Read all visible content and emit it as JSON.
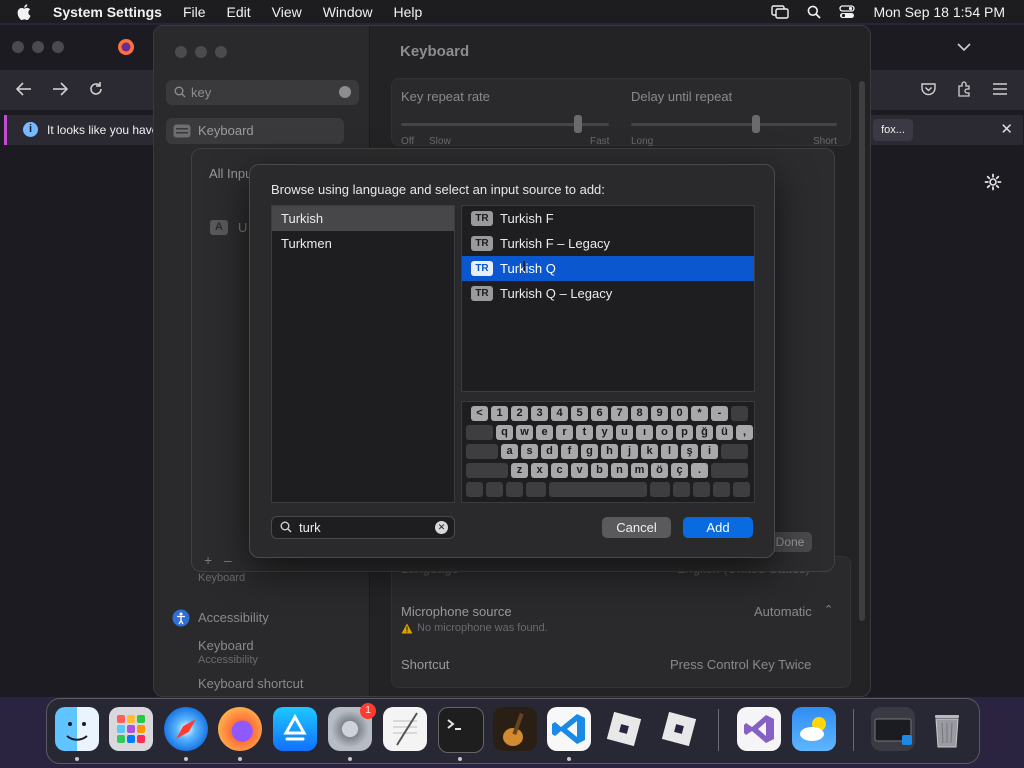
{
  "menubar": {
    "app_name": "System Settings",
    "menus": [
      "File",
      "Edit",
      "View",
      "Window",
      "Help"
    ],
    "datetime": "Mon Sep 18  1:54 PM"
  },
  "browser": {
    "notice_text": "It looks like you have",
    "notice_button": "fox..."
  },
  "settings": {
    "window_title": "Keyboard",
    "search_value": "key",
    "sidebar_selected": "Keyboard",
    "sidebar_items": [
      {
        "label": "Keyboard",
        "sub": ""
      },
      {
        "label": "Accessibility",
        "sub": ""
      },
      {
        "label": "Keyboard",
        "sub": "Accessibility"
      },
      {
        "label": "Keyboard shortcut",
        "sub": ""
      }
    ],
    "sidebar_keyboard_caption": "Keyboard",
    "key_repeat_rate": {
      "label": "Key repeat rate",
      "left": "Off",
      "left2": "Slow",
      "right": "Fast",
      "level": 0.85
    },
    "delay_until_repeat": {
      "label": "Delay until repeat",
      "left": "Long",
      "right": "Short",
      "level": 0.6
    },
    "language_label": "Language",
    "language_value": "English (United States)",
    "microphone_label": "Microphone source",
    "microphone_value": "Automatic",
    "microphone_warning": "No microphone was found.",
    "shortcut_label": "Shortcut",
    "shortcut_value": "Press Control Key Twice"
  },
  "input_sheet": {
    "heading": "All Inpu",
    "source_badge": "A",
    "source_label": "U",
    "done_label": "Done"
  },
  "dialog": {
    "prompt": "Browse using language and select an input source to add:",
    "languages": [
      {
        "label": "Turkish",
        "selected": true
      },
      {
        "label": "Turkmen",
        "selected": false
      }
    ],
    "sources": [
      {
        "badge": "TR",
        "label": "Turkish F",
        "selected": false
      },
      {
        "badge": "TR",
        "label": "Turkish F – Legacy",
        "selected": false
      },
      {
        "badge": "TR",
        "label": "Turkish Q",
        "selected": true
      },
      {
        "badge": "TR",
        "label": "Turkish Q – Legacy",
        "selected": false
      }
    ],
    "keyboard_rows": [
      [
        "<",
        "1",
        "2",
        "3",
        "4",
        "5",
        "6",
        "7",
        "8",
        "9",
        "0",
        "*",
        "-"
      ],
      [
        "q",
        "w",
        "e",
        "r",
        "t",
        "y",
        "u",
        "ı",
        "o",
        "p",
        "ğ",
        "ü",
        ","
      ],
      [
        "a",
        "s",
        "d",
        "f",
        "g",
        "h",
        "j",
        "k",
        "l",
        "ş",
        "i"
      ],
      [
        "z",
        "x",
        "c",
        "v",
        "b",
        "n",
        "m",
        "ö",
        "ç",
        "."
      ]
    ],
    "search_value": "turk",
    "cancel_label": "Cancel",
    "add_label": "Add"
  },
  "dock": {
    "apps": [
      "Finder",
      "Launchpad",
      "Safari",
      "Firefox",
      "App Store",
      "System Settings",
      "TextEdit",
      "Terminal",
      "GarageBand",
      "Visual Studio Code",
      "Roblox",
      "Roblox Studio",
      "Visual Studio",
      "Weather",
      "Screen",
      "Trash"
    ],
    "settings_badge": "1"
  },
  "colors": {
    "accent": "#0a57d0",
    "add_button": "#0a6be0",
    "badge_red": "#ff3b30"
  }
}
